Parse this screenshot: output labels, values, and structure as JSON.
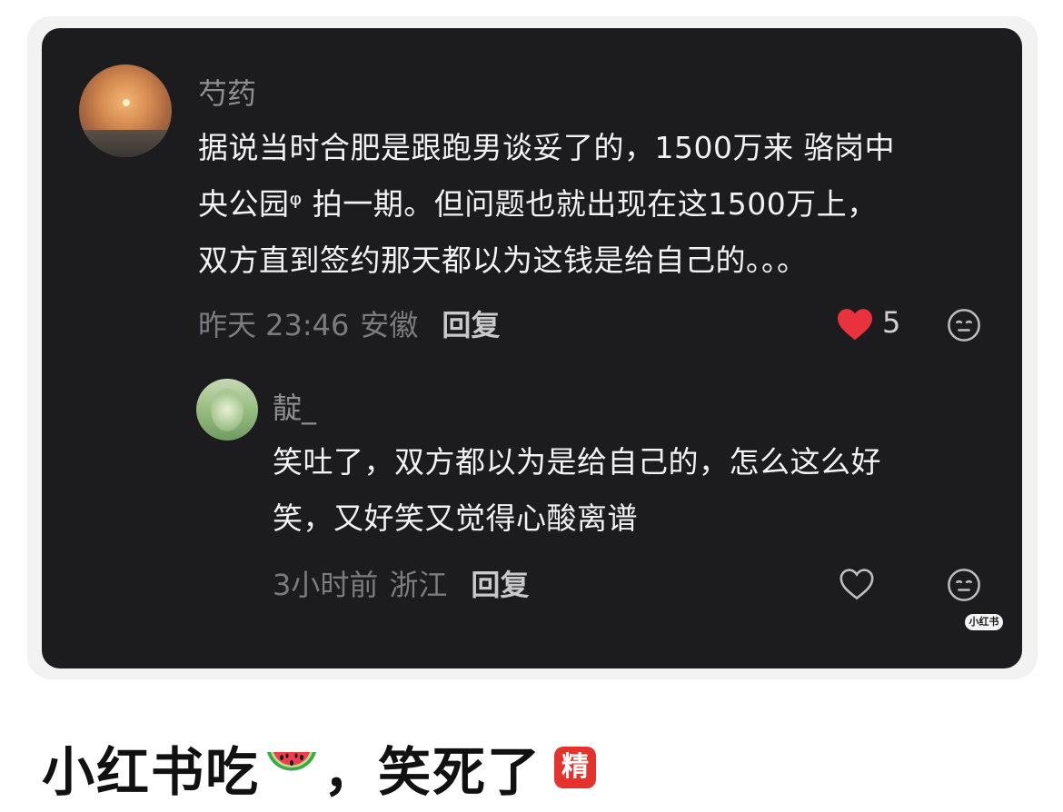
{
  "comment": {
    "username": "芍药",
    "text_lines": [
      "据说当时合肥是跟跑男谈妥了的，1500万来 骆岗中",
      "央公园ᵠ 拍一期。但问题也就出现在这1500万上，",
      "双方直到签约那天都以为这钱是给自己的。。。"
    ],
    "time": "昨天 23:46",
    "location": "安徽",
    "reply_label": "回复",
    "likes": "5"
  },
  "reply": {
    "username": "靛_",
    "text_lines": [
      "笑吐了，双方都以为是给自己的，怎么这么好",
      "笑，又好笑又觉得心酸离谱"
    ],
    "time": "3小时前",
    "location": "浙江",
    "reply_label": "回复"
  },
  "watermark": "小红书",
  "post": {
    "title_part1": "小红书吃",
    "title_part2": "，笑死了",
    "badge": "精"
  },
  "colors": {
    "card_bg": "#1c1c1e",
    "heart": "#e8323c",
    "badge": "#e4322d"
  }
}
